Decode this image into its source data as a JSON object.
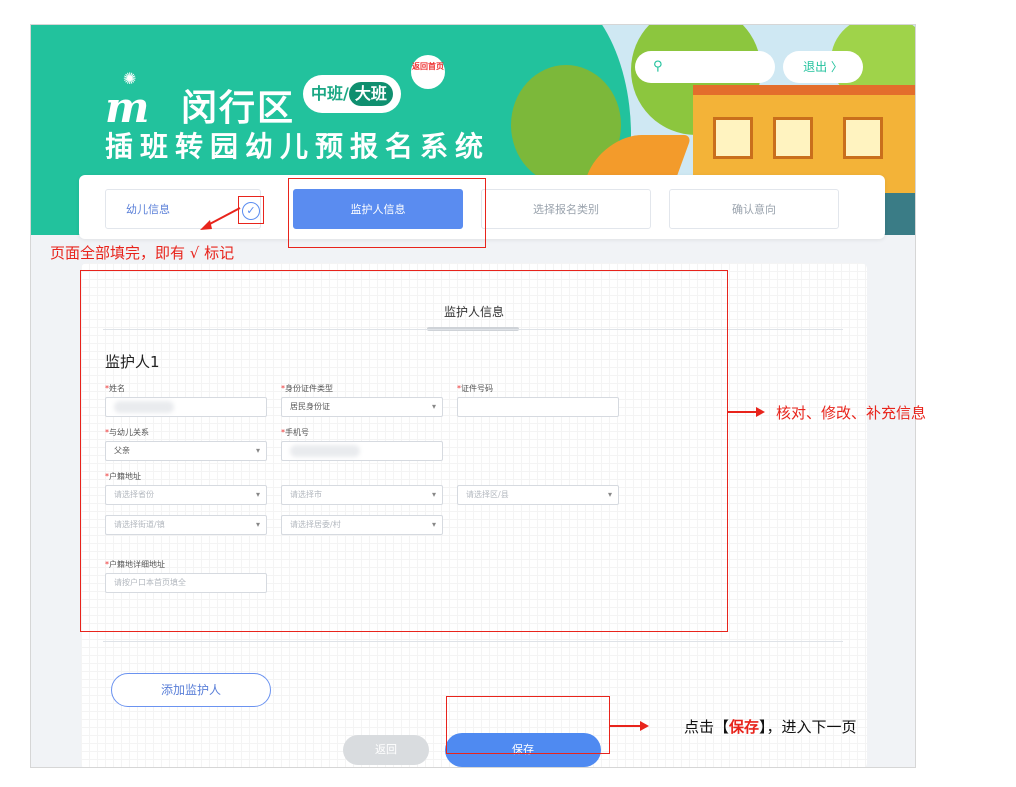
{
  "header": {
    "logo_letter": "m",
    "district": "闵行区",
    "class_middle": "中班",
    "class_big": "大班",
    "home_link": "返回首页",
    "system_title": "插班转园幼儿预报名系统",
    "logout": "退出 〉"
  },
  "steps": [
    {
      "label": "幼儿信息",
      "state": "done"
    },
    {
      "label": "监护人信息",
      "state": "active"
    },
    {
      "label": "选择报名类别",
      "state": "pending"
    },
    {
      "label": "确认意向",
      "state": "pending"
    }
  ],
  "form": {
    "section_title": "监护人信息",
    "guardian_heading": "监护人1",
    "labels": {
      "name": "姓名",
      "id_type": "身份证件类型",
      "id_number": "证件号码",
      "relation": "与幼儿关系",
      "phone": "手机号",
      "hukou_address": "户籍地址",
      "hukou_detail": "户籍地详细地址"
    },
    "values": {
      "id_type": "居民身份证",
      "relation": "父亲"
    },
    "placeholders": {
      "province": "请选择省份",
      "city": "请选择市",
      "district": "请选择区/县",
      "street": "请选择街道/镇",
      "committee": "请选择居委/村",
      "detail": "请按户口本首页填全"
    },
    "add_guardian": "添加监护人",
    "back": "返回",
    "save": "保存"
  },
  "annotations": {
    "check_note": "页面全部填完，即有 √ 标记",
    "verify_note": "核对、修改、补充信息",
    "save_note_prefix": "点击【",
    "save_note_highlight": "保存",
    "save_note_suffix": "】，进入下一页"
  },
  "colors": {
    "banner_green": "#22c29d",
    "primary_blue": "#4f8af1",
    "annotation_red": "#e8241c"
  }
}
